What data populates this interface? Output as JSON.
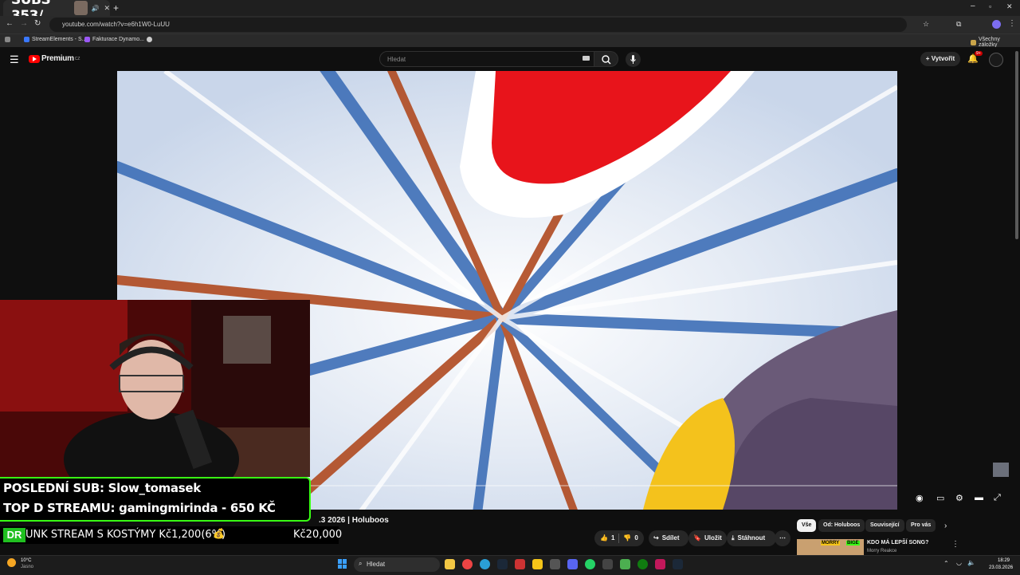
{
  "browser": {
    "tab_overlay_text": "SUBS 353/",
    "url": "youtube.com/watch?v=e6h1W0-LuUU",
    "bookmarks": [
      "StreamElements - S...",
      "Fakturace Dynamo..."
    ],
    "all_bookmarks_label": "Všechny záložky"
  },
  "youtube": {
    "logo_label": "Premium",
    "logo_superscript": "CZ",
    "search_placeholder": "Hledat",
    "create_label": "Vytvořit",
    "notification_count": "9+"
  },
  "video": {
    "title_visible": ".3 2026 | Holuboos",
    "progress_fraction": 0.0,
    "actions": {
      "like_count": "1",
      "dislike_count": "0",
      "share_label": "Sdílet",
      "save_label": "Uložit",
      "download_label": "Stáhnout"
    }
  },
  "stream_overlay": {
    "last_sub": "POSLEDNÍ SUB: Slow_tomasek",
    "top_donation": "TOP D STREAMU: gamingmirinda - 650 KČ",
    "goal_prefix": "DR",
    "goal_text": "UNK STREAM S KOSTÝMY Kč1,200(6%)",
    "goal_icon": "💰",
    "goal_target": "Kč20,000"
  },
  "chips": [
    "Vše",
    "Od: Holuboos",
    "Související",
    "Pro vás"
  ],
  "related": {
    "title": "KDO MÁ LEPŠÍ SONG?",
    "channel": "Morry Reakce",
    "thumb_text_1": "MORRY",
    "thumb_text_2": "BIGE"
  },
  "taskbar": {
    "weather_temp": "10°C",
    "weather_desc": "Jasno",
    "search_label": "Hledat",
    "time": "18:29",
    "date": "23.03.2026"
  },
  "colors": {
    "accent_green": "#39ff14",
    "yt_red": "#ff0000"
  }
}
